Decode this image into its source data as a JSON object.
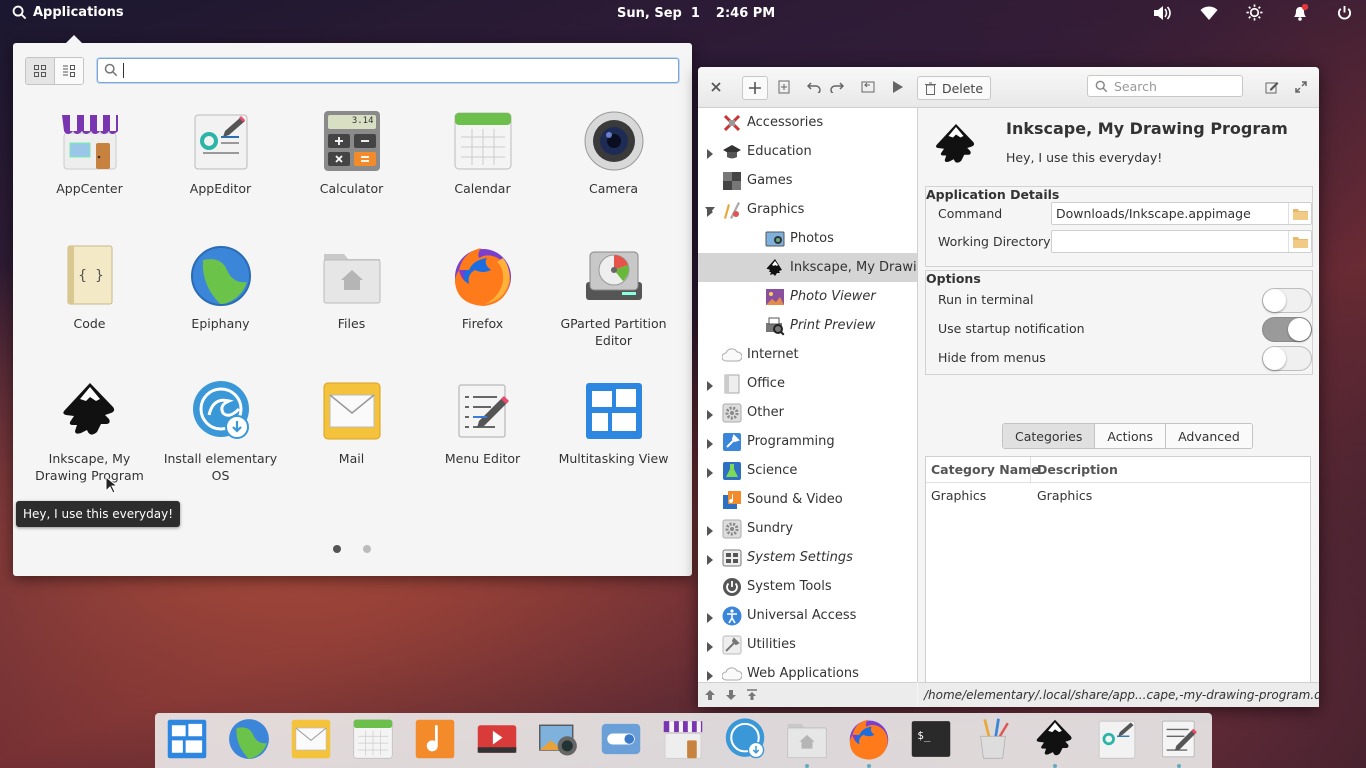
{
  "panel": {
    "applications_label": "Applications",
    "date": "Sun, Sep  1",
    "time": "2:46 PM",
    "icons": [
      "search-icon",
      "volume-icon",
      "wifi-icon",
      "brightness-icon",
      "notifications-icon",
      "power-icon"
    ]
  },
  "launcher": {
    "search_value": "",
    "apps": [
      {
        "label": "AppCenter",
        "icon": "appcenter-icon"
      },
      {
        "label": "AppEditor",
        "icon": "appeditor-icon"
      },
      {
        "label": "Calculator",
        "icon": "calculator-icon"
      },
      {
        "label": "Calendar",
        "icon": "calendar-icon"
      },
      {
        "label": "Camera",
        "icon": "camera-icon"
      },
      {
        "label": "Code",
        "icon": "code-icon"
      },
      {
        "label": "Epiphany",
        "icon": "epiphany-icon"
      },
      {
        "label": "Files",
        "icon": "files-icon"
      },
      {
        "label": "Firefox",
        "icon": "firefox-icon"
      },
      {
        "label": "GParted Partition Editor",
        "icon": "gparted-icon"
      },
      {
        "label": "Inkscape, My Drawing Program",
        "icon": "inkscape-icon"
      },
      {
        "label": "Install elementary OS",
        "icon": "installer-icon"
      },
      {
        "label": "Mail",
        "icon": "mail-icon"
      },
      {
        "label": "Menu Editor",
        "icon": "menu-editor-icon"
      },
      {
        "label": "Multitasking View",
        "icon": "multitasking-icon"
      }
    ],
    "calculator_display": "3.14",
    "tooltip": "Hey, I use this everyday!",
    "pages": 2,
    "current_page": 1
  },
  "editor": {
    "toolbar": {
      "delete_label": "Delete",
      "search_placeholder": "Search"
    },
    "tree": [
      {
        "label": "Accessories",
        "expander": "right",
        "indent": 0
      },
      {
        "label": "Education",
        "expander": "none",
        "indent": 0
      },
      {
        "label": "Games",
        "expander": "right",
        "indent": 0
      },
      {
        "label": "Graphics",
        "expander": "down",
        "indent": 0
      },
      {
        "label": "Photos",
        "expander": "none",
        "indent": 1
      },
      {
        "label": "Inkscape, My Drawi...",
        "expander": "none",
        "indent": 1,
        "selected": true
      },
      {
        "label": "Photo Viewer",
        "expander": "none",
        "indent": 1,
        "italic": true
      },
      {
        "label": "Print Preview",
        "expander": "none",
        "indent": 1,
        "italic": true
      },
      {
        "label": "Internet",
        "expander": "right",
        "indent": 0
      },
      {
        "label": "Office",
        "expander": "right",
        "indent": 0
      },
      {
        "label": "Other",
        "expander": "right",
        "indent": 0
      },
      {
        "label": "Programming",
        "expander": "right",
        "indent": 0
      },
      {
        "label": "Science",
        "expander": "none",
        "indent": 0
      },
      {
        "label": "Sound & Video",
        "expander": "right",
        "indent": 0
      },
      {
        "label": "Sundry",
        "expander": "right",
        "indent": 0
      },
      {
        "label": "System Settings",
        "expander": "none",
        "indent": 0,
        "italic": true
      },
      {
        "label": "System Tools",
        "expander": "right",
        "indent": 0
      },
      {
        "label": "Universal Access",
        "expander": "right",
        "indent": 0
      },
      {
        "label": "Utilities",
        "expander": "right",
        "indent": 0
      },
      {
        "label": "Web Applications",
        "expander": "none",
        "indent": 0
      }
    ],
    "app_name": "Inkscape, My Drawing Program",
    "app_comment": "Hey, I use this everyday!",
    "details": {
      "title": "Application Details",
      "command_label": "Command",
      "command_value": "Downloads/Inkscape.appimage",
      "workdir_label": "Working Directory",
      "workdir_value": ""
    },
    "options": {
      "title": "Options",
      "items": [
        {
          "label": "Run in terminal",
          "on": false
        },
        {
          "label": "Use startup notification",
          "on": true
        },
        {
          "label": "Hide from menus",
          "on": false
        }
      ]
    },
    "tabs": [
      "Categories",
      "Actions",
      "Advanced"
    ],
    "active_tab": "Categories",
    "categories": {
      "col_name": "Category Name",
      "col_desc": "Description",
      "rows": [
        {
          "name": "Graphics",
          "desc": "Graphics"
        }
      ]
    },
    "status_path": "/home/elementary/.local/share/app...cape,-my-drawing-program.desktop"
  },
  "dock": [
    "multitasking-icon",
    "epiphany-icon",
    "mail-icon",
    "calendar-icon",
    "music-icon",
    "videos-icon",
    "photos-icon",
    "settings-icon",
    "appcenter-icon",
    "installer-icon",
    "files-icon",
    "firefox-icon",
    "terminal-icon",
    "paint-icon",
    "inkscape-icon",
    "appeditor-icon",
    "menu-editor-icon"
  ],
  "colors": {
    "accent": "#3689e6",
    "selection": "#d5d5d5",
    "panel_text": "#ffffff"
  }
}
